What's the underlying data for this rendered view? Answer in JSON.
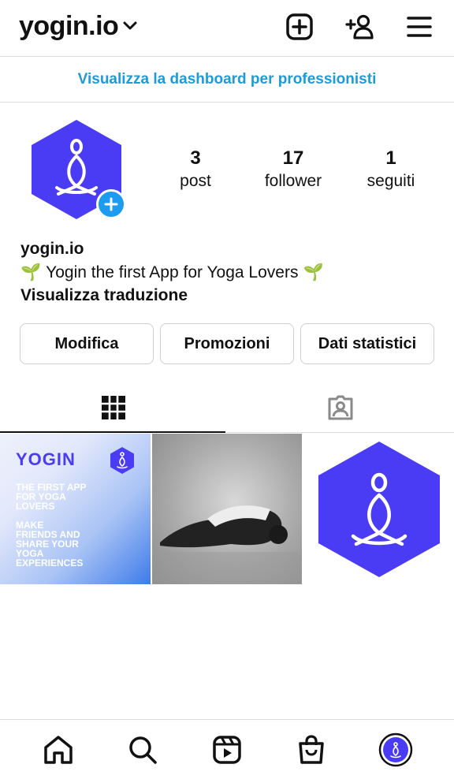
{
  "header": {
    "username": "yogin.io"
  },
  "pro_dashboard": {
    "label": "Visualizza la dashboard per professionisti"
  },
  "profile": {
    "stats": [
      {
        "value": "3",
        "label": "post"
      },
      {
        "value": "17",
        "label": "follower"
      },
      {
        "value": "1",
        "label": "seguiti"
      }
    ],
    "name": "yogin.io",
    "bio": "Yogin the first App for Yoga Lovers",
    "bio_emoji": "🌱",
    "translate": "Visualizza traduzione"
  },
  "actions": {
    "edit": "Modifica",
    "promotions": "Promozioni",
    "insights": "Dati statistici"
  },
  "posts": {
    "post1": {
      "title": "YOGIN",
      "line_a": "THE FIRST APP\nFOR YOGA\nLOVERS",
      "line_b": "MAKE\nFRIENDS AND\nSHARE YOUR\nYOGA\nEXPERIENCES"
    }
  },
  "colors": {
    "brand_purple": "#4a3cf4",
    "link_blue": "#1d9bd8",
    "badge_blue": "#1d9bf0"
  },
  "icons": {
    "top": [
      "create-post-icon",
      "add-person-icon",
      "menu-icon"
    ],
    "tabs": [
      "grid-icon",
      "tagged-icon"
    ],
    "bottom": [
      "home-icon",
      "search-icon",
      "reels-icon",
      "shop-icon",
      "profile-avatar-icon"
    ]
  }
}
